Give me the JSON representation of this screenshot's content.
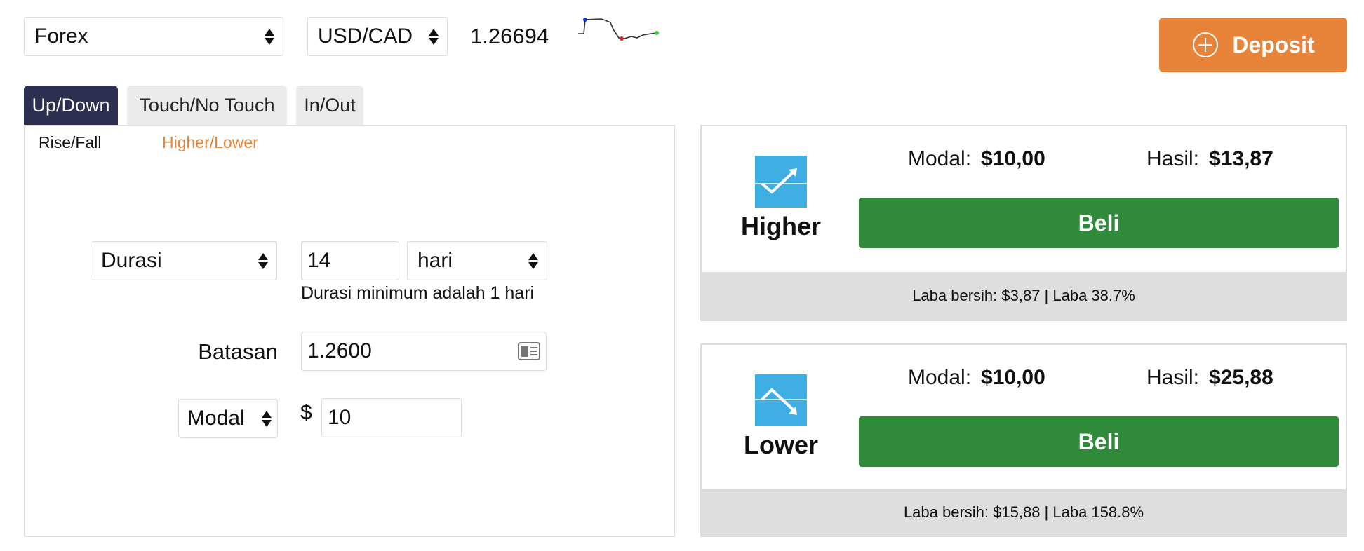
{
  "header": {
    "market_select": "Forex",
    "pair_select": "USD/CAD",
    "price": "1.26694",
    "deposit_label": "Deposit"
  },
  "tabs": [
    {
      "label": "Up/Down",
      "active": true
    },
    {
      "label": "Touch/No Touch",
      "active": false
    },
    {
      "label": "In/Out",
      "active": false
    }
  ],
  "subtabs": [
    {
      "label": "Rise/Fall",
      "active": false
    },
    {
      "label": "Higher/Lower",
      "active": true
    }
  ],
  "form": {
    "duration_select": "Durasi",
    "duration_value": "14",
    "duration_unit": "hari",
    "duration_hint": "Durasi minimum adalah 1 hari",
    "barrier_label": "Batasan",
    "barrier_value": "1.2600",
    "stake_select": "Modal",
    "currency_symbol": "$",
    "stake_value": "10"
  },
  "cards": [
    {
      "title": "Higher",
      "stake_label": "Modal:",
      "stake_value": "$10,00",
      "payout_label": "Hasil:",
      "payout_value": "$13,87",
      "buy_label": "Beli",
      "profit_text": "Laba bersih: $3,87 | Laba 38.7%",
      "icon": "higher-trend-icon"
    },
    {
      "title": "Lower",
      "stake_label": "Modal:",
      "stake_value": "$10,00",
      "payout_label": "Hasil:",
      "payout_value": "$25,88",
      "buy_label": "Beli",
      "profit_text": "Laba bersih: $15,88 | Laba 158.8%",
      "icon": "lower-trend-icon"
    }
  ],
  "colors": {
    "accent_orange": "#e8843a",
    "active_tab": "#2b3050",
    "buy_green": "#2f8a3a",
    "icon_blue": "#3eaee3"
  }
}
